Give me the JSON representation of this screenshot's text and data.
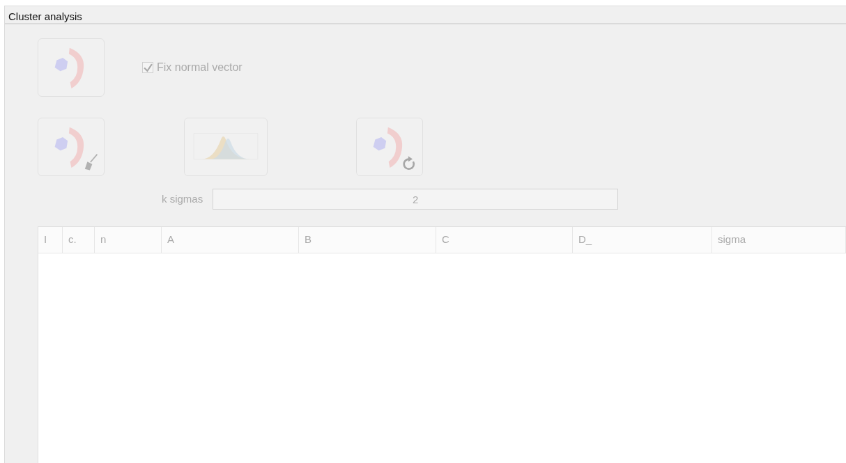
{
  "panel": {
    "title": "Cluster analysis"
  },
  "top_button": {
    "kind": "scatter",
    "disabled": true
  },
  "fix_normal_vector": {
    "label": "Fix normal vector",
    "checked": true,
    "disabled": true
  },
  "buttons": [
    {
      "kind": "scatter-broom",
      "disabled": true
    },
    {
      "kind": "histogram",
      "disabled": true
    },
    {
      "kind": "scatter-refresh",
      "disabled": true
    }
  ],
  "k_sigmas": {
    "label": "k sigmas",
    "value": "2",
    "disabled": true
  },
  "table": {
    "columns": [
      "I",
      "c.",
      "n",
      "A",
      "B",
      "C",
      "D_",
      "sigma"
    ]
  }
}
